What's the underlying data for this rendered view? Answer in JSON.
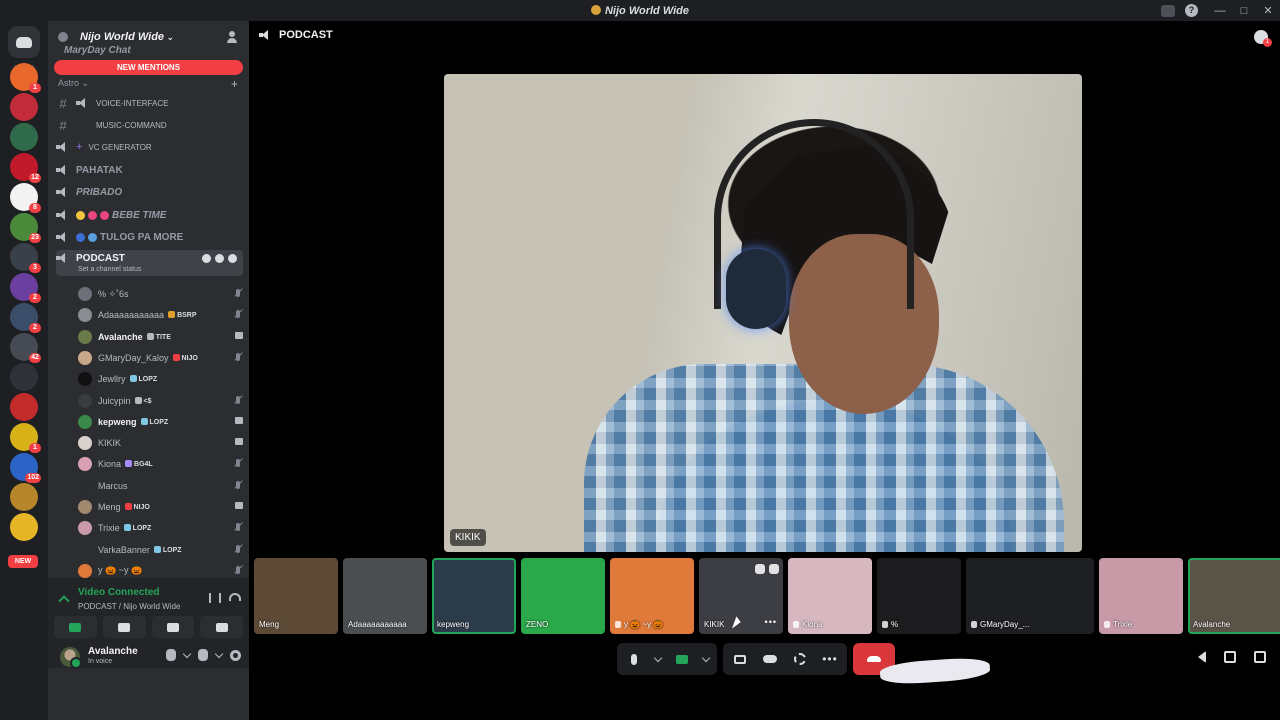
{
  "window": {
    "title": "Nijo World Wide"
  },
  "guilds": [
    {
      "color": "#e8672a",
      "badge": "1"
    },
    {
      "color": "#c22b3a",
      "badge": ""
    },
    {
      "color": "#2f6a4a",
      "badge": ""
    },
    {
      "color": "#c01a2b",
      "badge": "12"
    },
    {
      "color": "#f2f2f2",
      "badge": "8"
    },
    {
      "color": "#4a8a3a",
      "badge": "23"
    },
    {
      "color": "#39404a",
      "badge": "3"
    },
    {
      "color": "#6a3fa0",
      "badge": "2"
    },
    {
      "color": "#3a4e6a",
      "badge": "2"
    },
    {
      "color": "#464a52",
      "badge": "42"
    },
    {
      "color": "#2e3138",
      "badge": ""
    },
    {
      "color": "#c42c2c",
      "badge": ""
    },
    {
      "color": "#d6b118",
      "badge": "1"
    },
    {
      "color": "#2b63c7",
      "badge": "102"
    },
    {
      "color": "#b8862a",
      "badge": ""
    },
    {
      "color": "#e6b526",
      "badge": ""
    }
  ],
  "guild_new_label": "NEW",
  "server": {
    "name": "Nijo World Wide",
    "cut_channel": "MaryDay Chat",
    "new_mentions": "NEW MENTIONS",
    "category": "Astro",
    "channels": [
      {
        "type": "text",
        "label": "VOICE-INTERFACE"
      },
      {
        "type": "text",
        "label": "MUSIC-COMMAND"
      },
      {
        "type": "voice",
        "label": "VC GENERATOR"
      },
      {
        "type": "voice",
        "label": "PAHATAK"
      },
      {
        "type": "voice",
        "label": "PRIBADO"
      },
      {
        "type": "voice",
        "label": "BEBE TIME"
      },
      {
        "type": "voice",
        "label": "TULOG PA MORE"
      }
    ],
    "active_channel": {
      "label": "PODCAST",
      "status": "Set a channel status"
    }
  },
  "members": [
    {
      "name": "% ✧˚6s",
      "tag": "",
      "tagcolor": "",
      "state": "mute",
      "avatar": "#6b6f78",
      "bold": false
    },
    {
      "name": "Adaaaaaaaaaaa",
      "tag": "BSRP",
      "tagcolor": "#e0a030",
      "state": "mute",
      "avatar": "#8a8e94",
      "bold": false
    },
    {
      "name": "Avalanche",
      "tag": "TITE",
      "tagcolor": "#b5bac1",
      "state": "cam",
      "avatar": "#6b7a4a",
      "bold": true
    },
    {
      "name": "GMaryDay_Kaloy",
      "tag": "NIJO",
      "tagcolor": "#f23f43",
      "state": "mute",
      "avatar": "#c9a88a",
      "bold": false
    },
    {
      "name": "Jewllry",
      "tag": "LOPZ",
      "tagcolor": "#7ec8e3",
      "state": "",
      "avatar": "#111111",
      "bold": false
    },
    {
      "name": "Juicypin",
      "tag": "<$",
      "tagcolor": "#b5bac1",
      "state": "mute",
      "avatar": "#3a3c42",
      "bold": false
    },
    {
      "name": "kepweng",
      "tag": "LOPZ",
      "tagcolor": "#7ec8e3",
      "state": "cam",
      "avatar": "#3a8a4a",
      "bold": true
    },
    {
      "name": "KIKIK",
      "tag": "",
      "tagcolor": "",
      "state": "cam",
      "avatar": "#d9d2cc",
      "bold": false
    },
    {
      "name": "Kiona",
      "tag": "BG4L",
      "tagcolor": "#a78bfa",
      "state": "mute",
      "avatar": "#d8a0b0",
      "bold": false
    },
    {
      "name": "Marcus",
      "tag": "",
      "tagcolor": "",
      "state": "mute",
      "avatar": "#2a2c30",
      "bold": false
    },
    {
      "name": "Meng",
      "tag": "NIJO",
      "tagcolor": "#f23f43",
      "state": "cam",
      "avatar": "#a08a70",
      "bold": false
    },
    {
      "name": "Trixie",
      "tag": "LOPZ",
      "tagcolor": "#7ec8e3",
      "state": "mute",
      "avatar": "#c89aa8",
      "bold": false
    },
    {
      "name": "VarkaBanner",
      "tag": "LOPZ",
      "tagcolor": "#7ec8e3",
      "state": "mute",
      "avatar": "#2b2d31",
      "bold": false
    },
    {
      "name": "y 🎃 ~y 🎃",
      "tag": "",
      "tagcolor": "",
      "state": "mute",
      "avatar": "#e07a3a",
      "bold": false
    }
  ],
  "voice": {
    "status": "Video Connected",
    "channel": "PODCAST / Nijo World Wide"
  },
  "user": {
    "name": "Avalanche",
    "status": "In voice"
  },
  "main": {
    "channel_title": "PODCAST",
    "focused_label": "KIKIK"
  },
  "tiles": [
    {
      "name": "Meng",
      "muted": false,
      "color": "#5c4a36",
      "speaking": false
    },
    {
      "name": "Adaaaaaaaaaaa",
      "muted": false,
      "color": "#4b4e50",
      "speaking": false
    },
    {
      "name": "kepweng",
      "muted": false,
      "color": "#2c3b4a",
      "speaking": true
    },
    {
      "name": "ZENO",
      "muted": false,
      "color": "#2ba84a",
      "speaking": false
    },
    {
      "name": "y 🎃 ~y 🎃",
      "muted": true,
      "color": "#e07a3a",
      "speaking": false
    },
    {
      "name": "KIKIK",
      "muted": false,
      "color": "#3c3e44",
      "speaking": false,
      "hovered": true
    },
    {
      "name": "Kiona",
      "muted": true,
      "color": "#d8b8c0",
      "speaking": false
    },
    {
      "name": "%",
      "muted": true,
      "color": "#1c1c1e",
      "speaking": false
    },
    {
      "name": "GMaryDay_...",
      "muted": true,
      "color": "#1e1f22",
      "speaking": false,
      "wide": true
    },
    {
      "name": "Trixie",
      "muted": true,
      "color": "#c89aa8",
      "speaking": false
    },
    {
      "name": "Avalanche",
      "muted": false,
      "color": "#5a5448",
      "speaking": true,
      "wide": true
    }
  ]
}
